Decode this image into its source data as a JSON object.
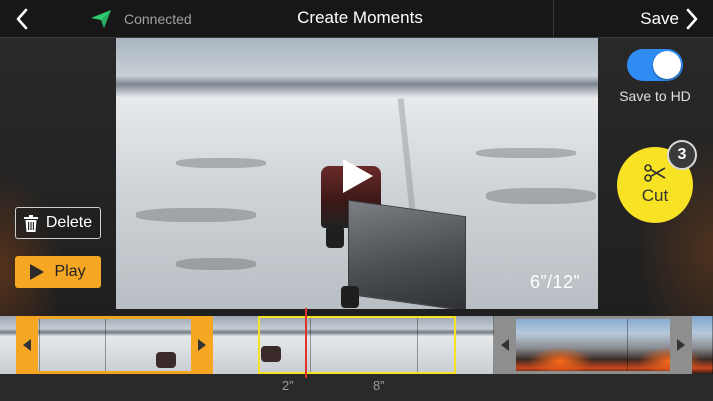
{
  "header": {
    "status_label": "Connected",
    "title": "Create Moments",
    "save_label": "Save"
  },
  "video": {
    "time_readout": "6”/12”"
  },
  "left_controls": {
    "delete_label": "Delete",
    "play_label": "Play"
  },
  "right_controls": {
    "hd_toggle_label": "Save to HD",
    "hd_toggle_on": true,
    "cut_label": "Cut",
    "cut_count": "3"
  },
  "timeline": {
    "marker_start": "2”",
    "marker_end": "8”"
  },
  "colors": {
    "accent_orange": "#f5a623",
    "accent_yellow": "#f7e224",
    "toggle_blue": "#2f8cf5",
    "status_green": "#2ecc71",
    "playhead_red": "#e0342b"
  },
  "icons": [
    "back-chevron-icon",
    "send-icon",
    "forward-chevron-icon",
    "trash-icon",
    "play-icon",
    "scissors-icon",
    "play-overlay-icon",
    "handle-left-arrow-icon",
    "handle-right-arrow-icon"
  ]
}
